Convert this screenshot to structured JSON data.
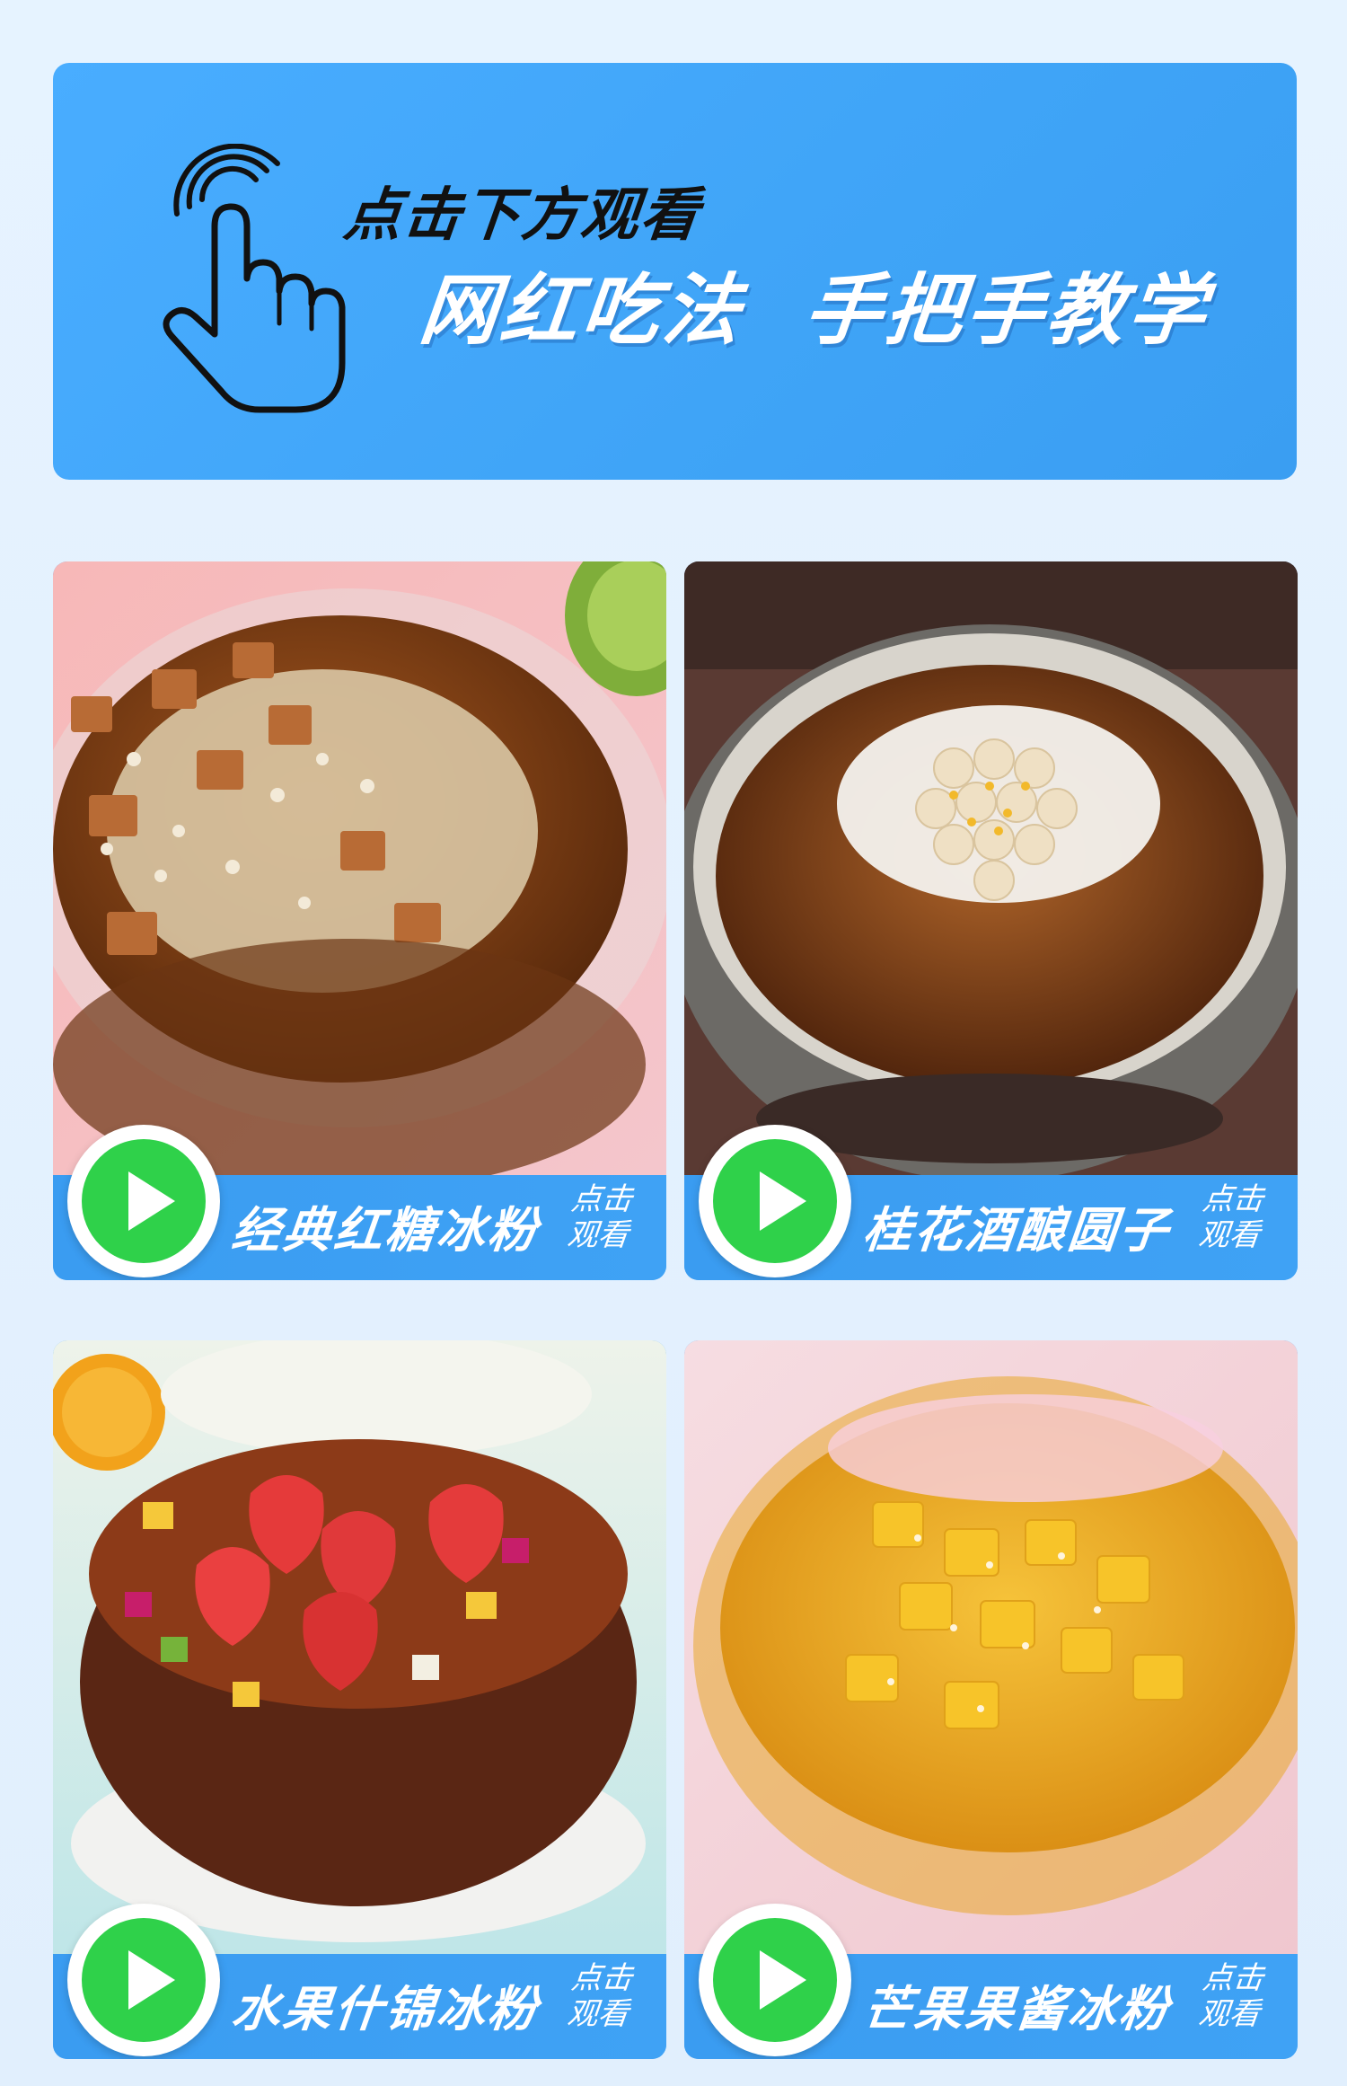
{
  "banner": {
    "line1": "点击下方观看",
    "line2": "网红吃法  手把手教学"
  },
  "cards": [
    {
      "title": "经典红糖冰粉",
      "cta_line1": "点击",
      "cta_line2": "观看",
      "image": "brown-sugar-ice-jelly-with-nuts-photo"
    },
    {
      "title": "桂花酒酿圆子",
      "cta_line1": "点击",
      "cta_line2": "观看",
      "image": "osmanthus-rice-wine-balls-photo"
    },
    {
      "title": "水果什锦冰粉",
      "cta_line1": "点击",
      "cta_line2": "观看",
      "image": "mixed-fruit-ice-jelly-photo"
    },
    {
      "title": "芒果果酱冰粉",
      "cta_line1": "点击",
      "cta_line2": "观看",
      "image": "mango-jam-ice-jelly-photo"
    }
  ],
  "colors": {
    "background": "#e3f1fe",
    "banner_blue": "#45a9fb",
    "bar_blue": "#3d9ff3",
    "play_green": "#2fd14a"
  }
}
